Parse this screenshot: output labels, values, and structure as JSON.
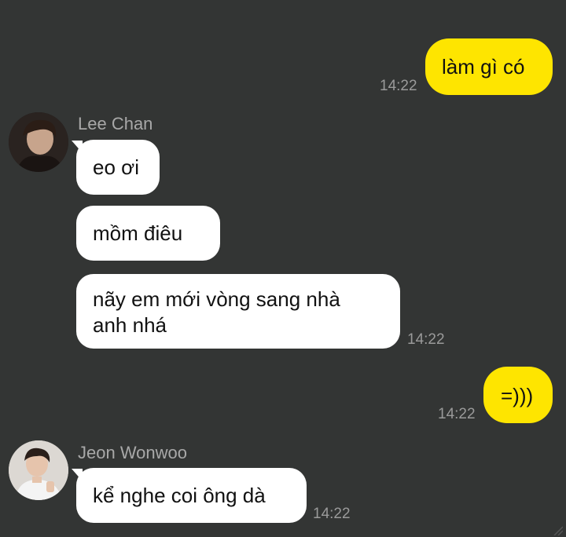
{
  "colors": {
    "background": "#333534",
    "outgoing_bubble": "#fee500",
    "incoming_bubble": "#ffffff",
    "timestamp": "#9a9a9a",
    "sender_name": "#a8a8a8"
  },
  "messages": {
    "m1": {
      "text": "làm gì có",
      "time": "14:22",
      "direction": "outgoing"
    },
    "g1": {
      "sender": "Lee Chan",
      "avatar_icon": "profile-photo-icon",
      "b1": {
        "text": "eo ơi"
      },
      "b2": {
        "text": "mồm điêu"
      },
      "b3": {
        "line1": "nãy em mới vòng sang nhà",
        "line2": "anh nhá"
      },
      "time": "14:22"
    },
    "m2": {
      "text": "=)))",
      "time": "14:22",
      "direction": "outgoing"
    },
    "g2": {
      "sender": "Jeon Wonwoo",
      "avatar_icon": "profile-photo-icon",
      "b1": {
        "text": "kể nghe coi ông dà"
      },
      "time": "14:22"
    }
  }
}
